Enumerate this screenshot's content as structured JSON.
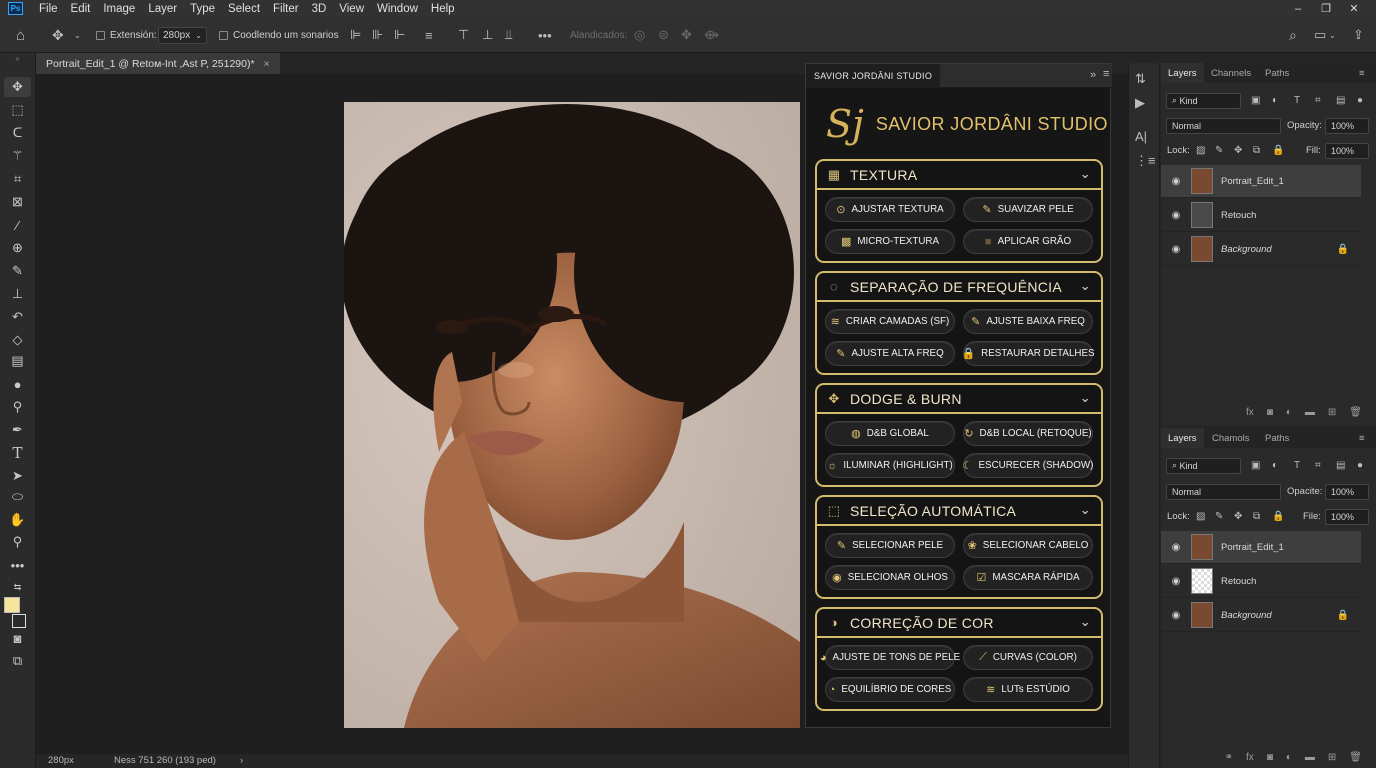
{
  "app": {
    "badge": "Ps"
  },
  "menu": [
    "File",
    "Edit",
    "Image",
    "Layer",
    "Type",
    "Select",
    "Filter",
    "3D",
    "View",
    "Window",
    "Help"
  ],
  "window_controls": [
    "–",
    "❐",
    "✕"
  ],
  "options": {
    "extension_label": "Extensión:",
    "extension_value": "280px",
    "coodlendo_label": "Coodlendo um sonarios",
    "align_label": "Alandicados:"
  },
  "document": {
    "tab_title": "Portrait_Edit_1 @ Retoм-Int ,Ast P, 251290)*",
    "close": "×",
    "status_zoom": "280px",
    "status_info": "Ness 751 260 (193 ped)",
    "status_arrow": "›"
  },
  "plugin": {
    "tab_title": "SAVIOR JORDÂNI STUDIO",
    "logo": "Sj",
    "brand_name": "SAVIOR JORDÂNI STUDIO",
    "sections": [
      {
        "title": "TEXTURA",
        "icon": "▦",
        "buttons": [
          {
            "label": "AJUSTAR TEXTURA",
            "icon": "⊙"
          },
          {
            "label": "SUAVIZAR PELE",
            "icon": "✎"
          },
          {
            "label": "MICRO-TEXTURA",
            "icon": "▩"
          },
          {
            "label": "APLICAR GRÃO",
            "icon": "■"
          }
        ]
      },
      {
        "title": "SEPARAÇÃO DE FREQUÊNCIA",
        "icon": "◌",
        "buttons": [
          {
            "label": "CRIAR CAMADAS (SF)",
            "icon": "≋"
          },
          {
            "label": "AJUSTE BAIXA FREQ",
            "icon": "✎"
          },
          {
            "label": "AJUSTE ALTA FREQ",
            "icon": "✎"
          },
          {
            "label": "RESTAURAR DETALHES",
            "icon": "🔒"
          }
        ]
      },
      {
        "title": "DODGE & BURN",
        "icon": "✥",
        "buttons": [
          {
            "label": "D&B GLOBAL",
            "icon": "◍"
          },
          {
            "label": "D&B LOCAL (RETOQUE)",
            "icon": "↻"
          },
          {
            "label": "ILUMINAR (HIGHLIGHT)",
            "icon": "☼"
          },
          {
            "label": "ESCURECER (SHADOW)",
            "icon": "☾"
          }
        ]
      },
      {
        "title": "SELEÇÃO AUTOMÁTICA",
        "icon": "⬚",
        "buttons": [
          {
            "label": "SELECIONAR PELE",
            "icon": "✎"
          },
          {
            "label": "SELECIONAR CABELO",
            "icon": "❀"
          },
          {
            "label": "SELECIONAR OLHOS",
            "icon": "◉"
          },
          {
            "label": "MASCARA RÁPIDA",
            "icon": "☑"
          }
        ]
      },
      {
        "title": "CORREÇÃO DE COR",
        "icon": "◑",
        "buttons": [
          {
            "label": "AJUSTE DE TONS DE PELE",
            "icon": "◕"
          },
          {
            "label": "CURVAS (COLOR)",
            "icon": "⟋"
          },
          {
            "label": "EQUILÍBRIO DE CORES",
            "icon": "◔"
          },
          {
            "label": "LUTs ESTÚDIO",
            "icon": "≋"
          }
        ]
      }
    ]
  },
  "layers_top": {
    "tabs": [
      "Layers",
      "Channels",
      "Paths"
    ],
    "kind": "Kind",
    "blend": "Normal",
    "opacity_label": "Opacity:",
    "opacity_value": "100%",
    "lock_label": "Lock:",
    "fill_label": "Fill:",
    "fill_value": "100%",
    "layers": [
      {
        "name": "Portrait_Edit_1",
        "selected": true,
        "locked": false,
        "italic": false
      },
      {
        "name": "Retouch",
        "selected": false,
        "locked": false,
        "italic": false
      },
      {
        "name": "Background",
        "selected": false,
        "locked": true,
        "italic": true
      }
    ]
  },
  "layers_bottom": {
    "tabs": [
      "Layers",
      "Chamols",
      "Paths"
    ],
    "kind": "Kind",
    "blend": "Normal",
    "opacity_label": "Opacite:",
    "opacity_value": "100%",
    "lock_label": "Lock:",
    "fill_label": "File:",
    "fill_value": "100%",
    "layers": [
      {
        "name": "Portrait_Edit_1",
        "selected": true,
        "locked": false,
        "italic": false
      },
      {
        "name": "Retouch",
        "selected": false,
        "locked": false,
        "italic": false
      },
      {
        "name": "Background",
        "selected": false,
        "locked": true,
        "italic": true
      }
    ]
  },
  "colors": {
    "accent_gold": "#d2bb6a",
    "foreground_swatch": "#f6e49a",
    "background_swatch": "#1e1e1e"
  }
}
